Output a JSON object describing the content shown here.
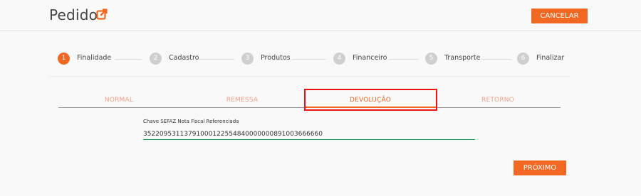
{
  "header": {
    "title": "Pedido",
    "cancel_label": "CANCELAR"
  },
  "stepper": {
    "steps": [
      {
        "number": "1",
        "label": "Finalidade"
      },
      {
        "number": "2",
        "label": "Cadastro"
      },
      {
        "number": "3",
        "label": "Produtos"
      },
      {
        "number": "4",
        "label": "Financeiro"
      },
      {
        "number": "5",
        "label": "Transporte"
      },
      {
        "number": "6",
        "label": "Finalizar"
      }
    ]
  },
  "tabs": {
    "items": [
      "NORMAL",
      "REMESSA",
      "DEVOLUÇÃO",
      "RETORNO"
    ],
    "active": "DEVOLUÇÃO"
  },
  "form": {
    "chave_label": "Chave SEFAZ Nota Fiscal Referenciada",
    "chave_value": "35220953113791000122554840000000891003666660"
  },
  "footer": {
    "next_label": "PRÓXIMO"
  },
  "colors": {
    "accent": "#f26722",
    "tab_inactive": "#f4a088",
    "field_underline": "#1f9a55",
    "highlight": "#ee1111"
  }
}
